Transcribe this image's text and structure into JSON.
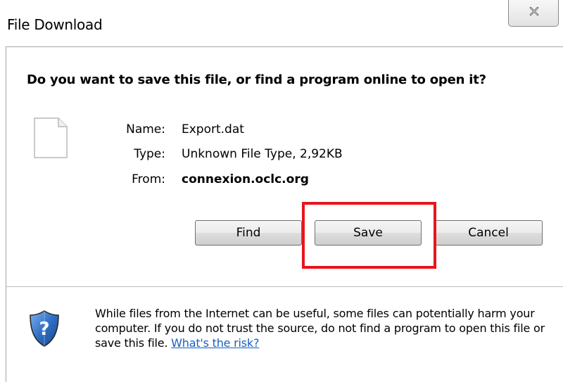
{
  "window": {
    "title": "File Download",
    "close_label": "Close"
  },
  "dialog": {
    "question": "Do you want to save this file, or find a program online to open it?",
    "file": {
      "name_label": "Name:",
      "name_value": "Export.dat",
      "type_label": "Type:",
      "type_value": "Unknown File Type, 2,92KB",
      "from_label": "From:",
      "from_value": "connexion.oclc.org"
    },
    "buttons": {
      "find": "Find",
      "save": "Save",
      "cancel": "Cancel"
    },
    "warning": {
      "text": "While files from the Internet can be useful, some files can potentially harm your computer. If you do not trust the source, do not find a program to open this file or save this file.",
      "link": "What's the risk?"
    }
  },
  "annotation": {
    "highlight_color": "#e8141c",
    "highlighted_element": "Save"
  },
  "icons": {
    "close": "close-icon",
    "file": "file-icon",
    "shield": "security-shield-icon"
  }
}
